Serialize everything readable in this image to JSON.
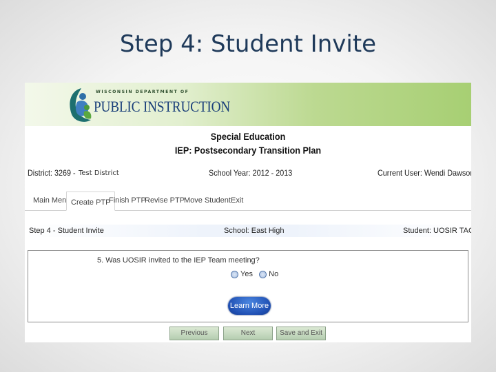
{
  "slide": {
    "title": "Step 4: Student Invite"
  },
  "banner": {
    "logo_top": "WISCONSIN DEPARTMENT OF",
    "logo_main": "PUBLIC INSTRUCTION"
  },
  "header": {
    "line1": "Special Education",
    "line2": "IEP: Postsecondary Transition Plan"
  },
  "info": {
    "district_label": "District: 3269 -",
    "district_name": "Test District",
    "school_year": "School Year: 2012 - 2013",
    "current_user": "Current User: Wendi Dawson"
  },
  "nav": {
    "items": [
      "Main Menu",
      "Create PTP",
      "Finish PTP",
      "Revise PTP",
      "Move Student",
      "Exit"
    ],
    "active": "Create PTP"
  },
  "step_bar": {
    "step": "Step 4 - Student Invite",
    "school": "School: East High",
    "student": "Student: UOSIR TAGDE"
  },
  "question": {
    "text": "5. Was UOSIR invited to the IEP Team meeting?",
    "options": [
      "Yes",
      "No"
    ]
  },
  "buttons": {
    "learn_more": "Learn More",
    "previous": "Previous",
    "next": "Next",
    "save_exit": "Save and Exit"
  },
  "colors": {
    "title": "#1f3a5a",
    "banner_green": "#a7cf73",
    "learn_more_blue": "#1f4fb3",
    "nav_button_green": "#b5cdb0"
  }
}
